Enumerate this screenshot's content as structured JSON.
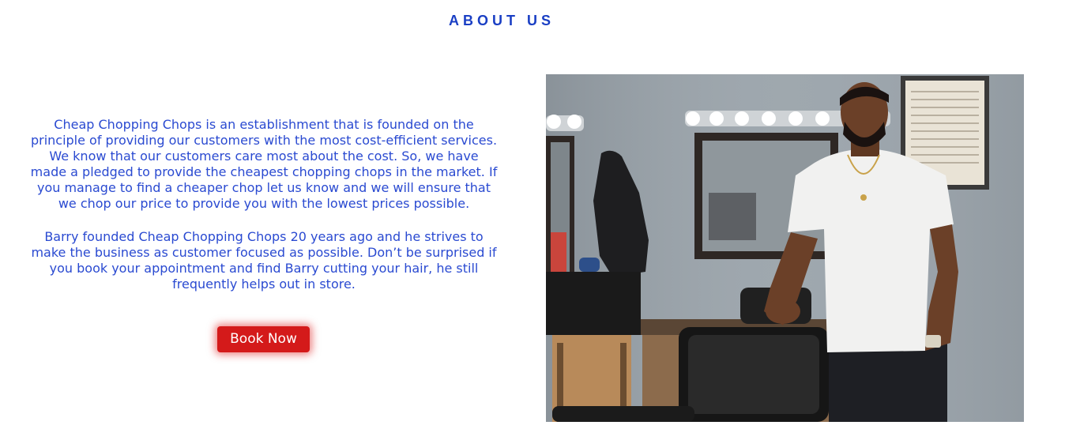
{
  "about": {
    "title": "ABOUT US",
    "paragraph_1": "Cheap Chopping Chops is an establishment that is founded on the principle of providing our customers with the most cost-efficient services. We know that our customers care most about the cost. So, we have made a pledged to provide the cheapest chopping chops in the market. If you manage to find a cheaper chop let us know and we will ensure that we chop our price to provide you with the lowest prices possible.",
    "paragraph_2": "Barry founded Cheap Chopping Chops 20 years ago and he strives to make the business as customer focused as possible. Don’t be surprised if you book your appointment and find Barry cutting your hair, he still frequently helps out in store.",
    "book_button_label": "Book Now"
  },
  "colors": {
    "heading": "#1a3fc4",
    "body_text": "#2a4ad1",
    "button_bg": "#d41a1a",
    "button_text": "#ffffff"
  },
  "image": {
    "icon": "barber-portrait-photo"
  }
}
